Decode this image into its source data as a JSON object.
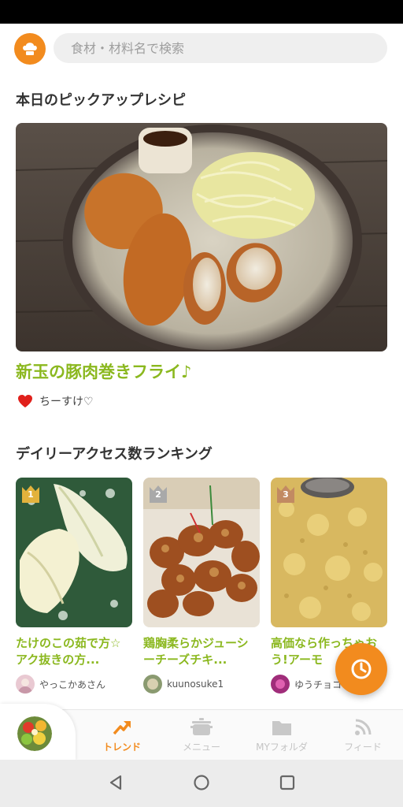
{
  "search": {
    "placeholder": "食材・材料名で検索"
  },
  "pickup": {
    "section_title": "本日のピックアップレシピ",
    "recipe_title": "新玉の豚肉巻きフライ♪",
    "author": "ちーすけ♡"
  },
  "ranking": {
    "section_title": "デイリーアクセス数ランキング",
    "items": [
      {
        "rank": "1",
        "title": "たけのこの茹で方☆アク抜きの方...",
        "author": "やっこかあさん"
      },
      {
        "rank": "2",
        "title": "鶏胸柔らかジューシーチーズチキ...",
        "author": "kuunosuke1"
      },
      {
        "rank": "3",
        "title": "高価なら作っちゃお う!アーモ",
        "author": "ゆうチョコ"
      }
    ]
  },
  "tabs": [
    {
      "label": "トレンド",
      "icon": "trend-icon",
      "active": true
    },
    {
      "label": "メニュー",
      "icon": "pot-icon",
      "active": false
    },
    {
      "label": "MYフォルダ",
      "icon": "folder-icon",
      "active": false
    },
    {
      "label": "フィード",
      "icon": "feed-icon",
      "active": false
    }
  ],
  "colors": {
    "accent": "#f28b1e",
    "title_green": "#8bb81f",
    "gold": "#e3b23c",
    "silver": "#a9a9a9",
    "bronze": "#c28a62"
  }
}
